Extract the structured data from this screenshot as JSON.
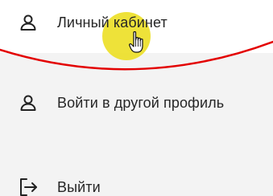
{
  "menu": {
    "items": [
      {
        "label": "Личный кабинет",
        "icon": "user-icon"
      },
      {
        "label": "Войти в другой профиль",
        "icon": "user-icon"
      },
      {
        "label": "Выйти",
        "icon": "logout-icon"
      }
    ]
  },
  "annotation": {
    "highlight_color": "#ece01e",
    "underline_color": "#e30000"
  },
  "cursor": {
    "icon": "hand-pointer-icon"
  }
}
